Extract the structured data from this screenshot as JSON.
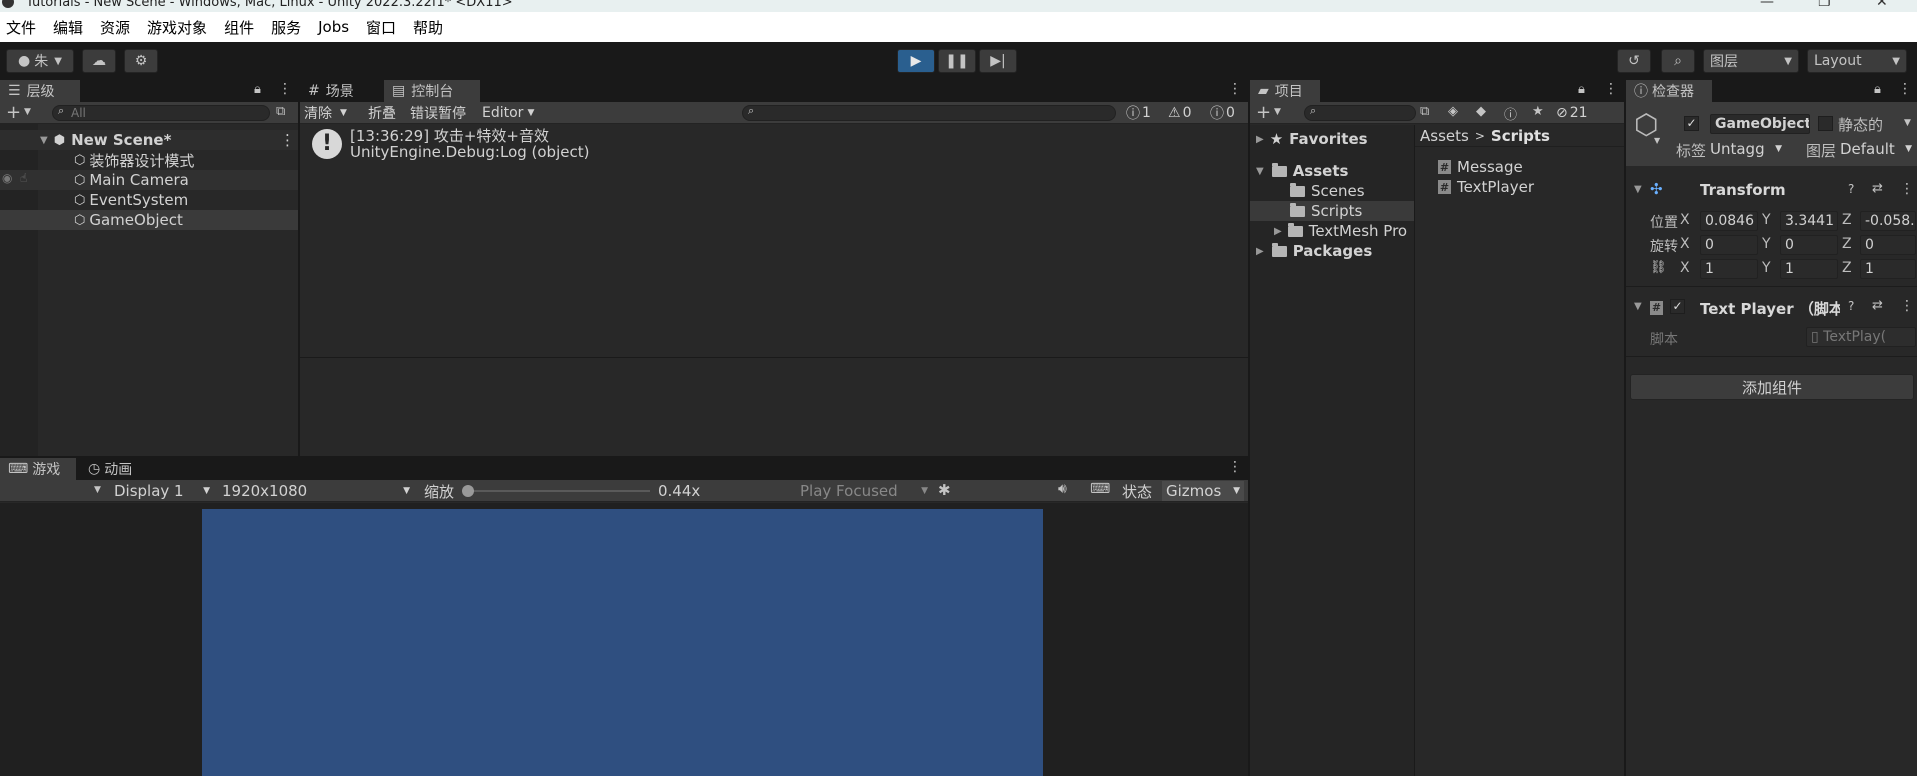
{
  "window": {
    "title": "Tutorials - New Scene - Windows, Mac, Linux - Unity 2022.3.22f1* <DX11>"
  },
  "menu": [
    "文件",
    "编辑",
    "资源",
    "游戏对象",
    "组件",
    "服务",
    "Jobs",
    "窗口",
    "帮助"
  ],
  "toolbar": {
    "account": "朱",
    "layers_label": "图层",
    "layout_label": "Layout"
  },
  "hierarchy": {
    "tab": "层级",
    "search_placeholder": "All",
    "scene": "New Scene*",
    "items": [
      "装饰器设计模式",
      "Main Camera",
      "EventSystem",
      "GameObject"
    ]
  },
  "scene_tab": "场景",
  "console": {
    "tab": "控制台",
    "clear": "清除",
    "collapse": "折叠",
    "error_pause": "错误暂停",
    "editor": "Editor",
    "count_info": "1",
    "count_warn": "0",
    "count_error": "0",
    "log_line1": "[13:36:29] 攻击+特效+音效",
    "log_line2": "UnityEngine.Debug:Log (object)"
  },
  "game": {
    "tab": "游戏",
    "anim_tab": "动画",
    "display": "Display 1",
    "resolution": "1920x1080",
    "scale_label": "缩放",
    "scale_value": "0.44x",
    "play_focused": "Play Focused",
    "stats": "状态",
    "gizmos": "Gizmos",
    "viewport_color": "#2f4f80"
  },
  "project": {
    "tab": "项目",
    "hidden_count": "21",
    "favorites": "Favorites",
    "assets": "Assets",
    "folders": [
      "Scenes",
      "Scripts",
      "TextMesh Pro"
    ],
    "packages": "Packages",
    "breadcrumb_root": "Assets",
    "breadcrumb_current": "Scripts",
    "files": [
      "Message",
      "TextPlayer"
    ]
  },
  "inspector": {
    "tab": "检查器",
    "object_name": "GameObject",
    "static_label": "静态的",
    "tag_label": "标签",
    "tag_value": "Untagg",
    "layer_label": "图层",
    "layer_value": "Default",
    "transform": "Transform",
    "position_label": "位置",
    "rotation_label": "旋转",
    "pos": {
      "x": "0.0846",
      "y": "3.3441",
      "z": "-0.058."
    },
    "rot": {
      "x": "0",
      "y": "0",
      "z": "0"
    },
    "scale": {
      "x": "1",
      "y": "1",
      "z": "1"
    },
    "component": "Text Player （脚本",
    "script_label": "脚本",
    "script_value": "TextPlay(",
    "add_component": "添加组件"
  }
}
